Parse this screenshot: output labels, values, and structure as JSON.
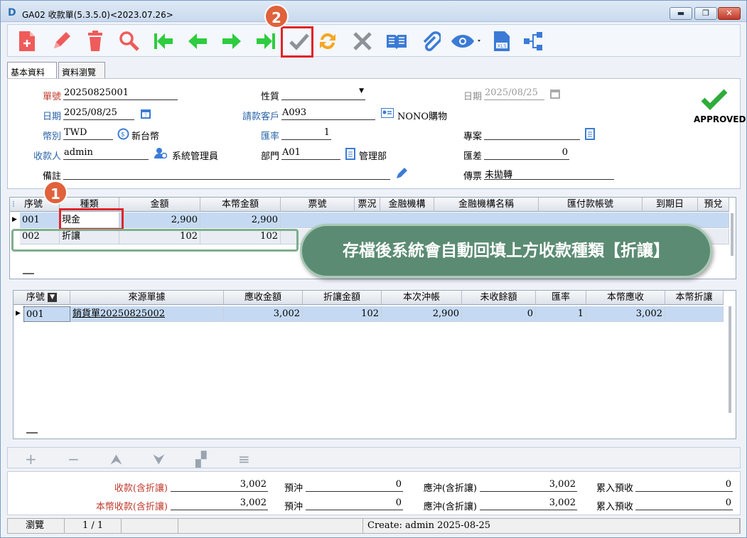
{
  "window": {
    "title": "GA02 收款單(5.3.5.0)<2023.07.26>",
    "min": "▬",
    "max": "❐",
    "close": "✕"
  },
  "tabs": [
    "基本資料",
    "資料瀏覽"
  ],
  "header": {
    "doc_no_label": "單號",
    "doc_no": "20250825001",
    "nature_label": "性質",
    "nature": "",
    "date1_label": "日期",
    "date1": "2025/08/25",
    "date_label": "日期",
    "date": "2025/08/25",
    "customer_label": "請款客戶",
    "customer": "A093",
    "customer_name": "NONO購物",
    "currency_label": "幣別",
    "currency": "TWD",
    "currency_name": "新台幣",
    "rate_label": "匯率",
    "rate": "1",
    "project_label": "專案",
    "project": "",
    "payee_label": "收款人",
    "payee": "admin",
    "payee_name": "系統管理員",
    "dept_label": "部門",
    "dept": "A01",
    "dept_name": "管理部",
    "diff_label": "匯差",
    "diff": "0",
    "note_label": "備註",
    "note": "",
    "voucher_label": "傳票",
    "voucher": "未拋轉",
    "approved": "APPROVED"
  },
  "grid1": {
    "headers": [
      "序號",
      "種類",
      "金額",
      "本幣金額",
      "票號",
      "票況",
      "金融機構",
      "金融機構名稱",
      "匯付款帳號",
      "到期日",
      "預兌"
    ],
    "rows": [
      {
        "seq": "001",
        "type": "現金",
        "amount": "2,900",
        "local": "2,900"
      },
      {
        "seq": "002",
        "type": "折讓",
        "amount": "102",
        "local": "102"
      }
    ]
  },
  "grid2": {
    "headers": [
      "序號",
      "來源單據",
      "應收金額",
      "折讓金額",
      "本次沖帳",
      "未收餘額",
      "匯率",
      "本幣應收",
      "本幣折讓"
    ],
    "rows": [
      {
        "seq": "001",
        "source": "銷貨單20250825002",
        "receivable": "3,002",
        "discount": "102",
        "offset": "2,900",
        "remaining": "0",
        "rate": "1",
        "local_receivable": "3,002"
      }
    ]
  },
  "callout": "存檔後系統會自動回填上方收款種類【折讓】",
  "badges": [
    "1",
    "2"
  ],
  "totals": {
    "r1": [
      {
        "label": "收款(含折讓)",
        "value": "3,002"
      },
      {
        "label": "預沖",
        "value": "0"
      },
      {
        "label": "應沖(含折讓)",
        "value": "3,002"
      },
      {
        "label": "累入預收",
        "value": "0"
      }
    ],
    "r2": [
      {
        "label": "本幣收款(含折讓)",
        "value": "3,002"
      },
      {
        "label": "預沖",
        "value": "0"
      },
      {
        "label": "應沖(含折讓)",
        "value": "3,002"
      },
      {
        "label": "累入預收",
        "value": "0"
      }
    ]
  },
  "status": {
    "mode": "瀏覽",
    "page": "1 / 1",
    "create": "Create: admin 2025-08-25"
  },
  "colors": {
    "accent_red": "#e0242b",
    "callout_green": "#5b8b73",
    "toolbar_green": "#2ecc40",
    "badge": "#e0613b"
  }
}
